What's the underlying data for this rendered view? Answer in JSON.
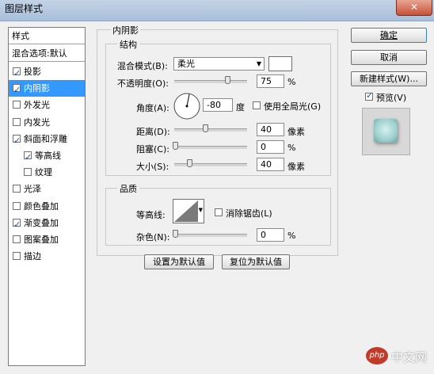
{
  "window": {
    "title": "图层样式",
    "close": "✕"
  },
  "left_panel": {
    "header": "样式",
    "subheader": "混合选项:默认",
    "items": [
      {
        "label": "投影",
        "checked": true
      },
      {
        "label": "内阴影",
        "checked": true,
        "selected": true
      },
      {
        "label": "外发光",
        "checked": false
      },
      {
        "label": "内发光",
        "checked": false
      },
      {
        "label": "斜面和浮雕",
        "checked": true
      },
      {
        "label": "等高线",
        "checked": true,
        "indent": true
      },
      {
        "label": "纹理",
        "checked": false,
        "indent": true
      },
      {
        "label": "光泽",
        "checked": false
      },
      {
        "label": "颜色叠加",
        "checked": false
      },
      {
        "label": "渐变叠加",
        "checked": true
      },
      {
        "label": "图案叠加",
        "checked": false
      },
      {
        "label": "描边",
        "checked": false
      }
    ]
  },
  "inner_shadow": {
    "section_title": "内阴影",
    "structure": {
      "title": "结构",
      "blend_mode_label": "混合模式(B):",
      "blend_mode_value": "柔光",
      "opacity_label": "不透明度(O):",
      "opacity_value": "75",
      "opacity_percent": 75,
      "opacity_unit": "%",
      "angle_label": "角度(A):",
      "angle_value": "-80",
      "angle_unit": "度",
      "global_light_label": "使用全局光(G)",
      "global_light_checked": false,
      "distance_label": "距离(D):",
      "distance_value": "40",
      "distance_unit": "像素",
      "choke_label": "阻塞(C):",
      "choke_value": "0",
      "choke_unit": "%",
      "size_label": "大小(S):",
      "size_value": "40",
      "size_unit": "像素"
    },
    "quality": {
      "title": "品质",
      "contour_label": "等高线:",
      "antialias_label": "消除锯齿(L)",
      "antialias_checked": false,
      "noise_label": "杂色(N):",
      "noise_value": "0",
      "noise_unit": "%"
    },
    "make_default": "设置为默认值",
    "reset_default": "复位为默认值"
  },
  "right_buttons": {
    "ok": "确定",
    "cancel": "取消",
    "new_style": "新建样式(W)...",
    "preview_label": "预览(V)",
    "preview_checked": true
  },
  "watermark": {
    "text": "中文网",
    "logo": "php"
  },
  "colors": {
    "selection": "#3399ff",
    "shadow_swatch": "#ffffff",
    "preview_tile": "#9fcfcf"
  }
}
